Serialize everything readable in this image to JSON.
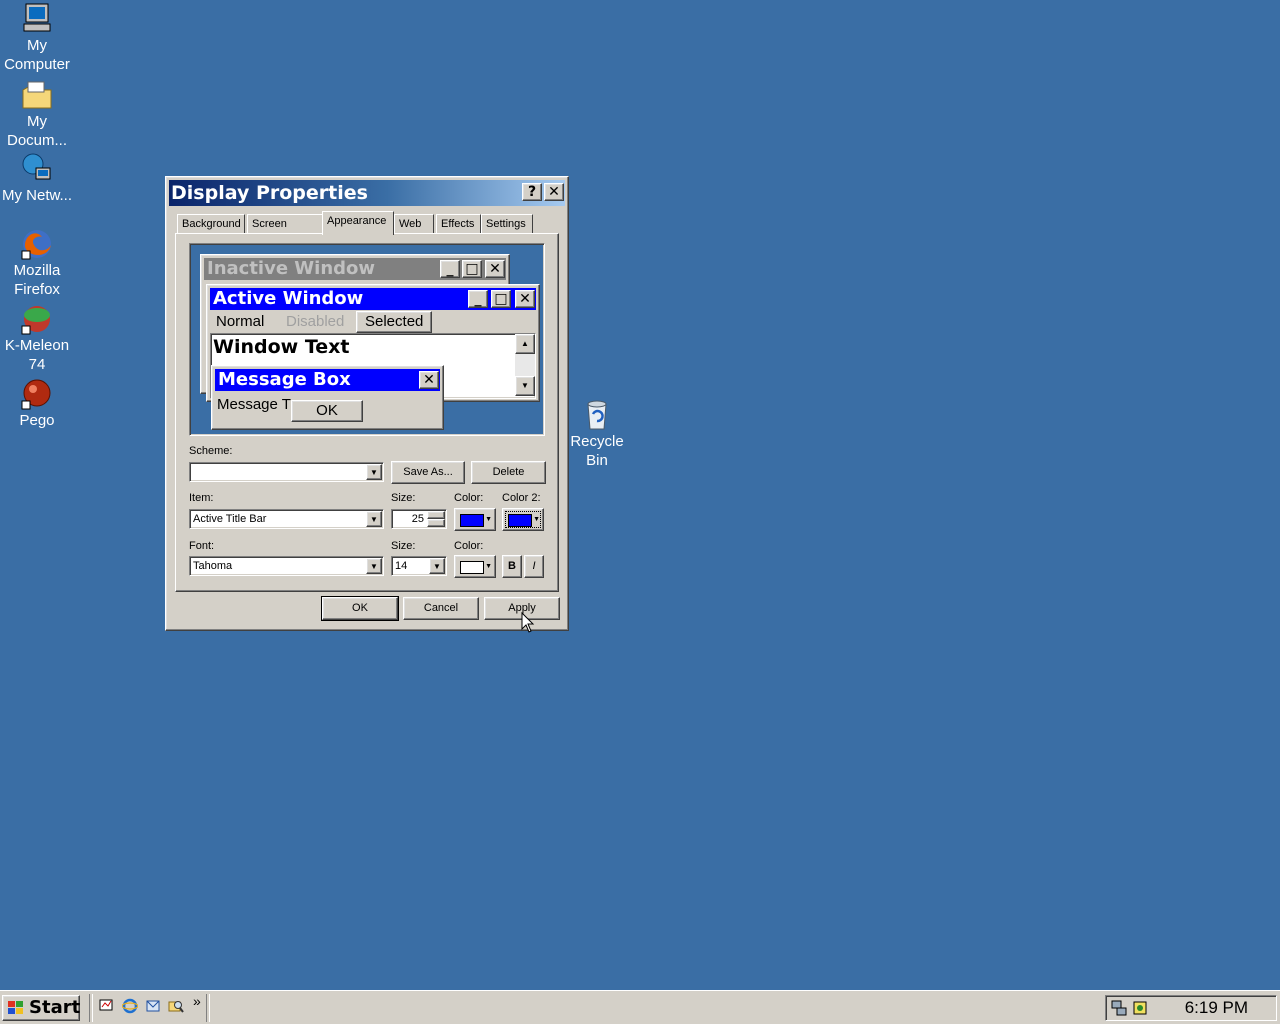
{
  "desktop": {
    "icons": [
      {
        "label": "My Computer",
        "icon": "my-computer-icon"
      },
      {
        "label": "My Docum...",
        "icon": "my-documents-icon"
      },
      {
        "label": "My Netw...",
        "icon": "network-icon"
      },
      {
        "label": "Mozilla Firefox",
        "icon": "firefox-icon"
      },
      {
        "label": "K-Meleon 74",
        "icon": "k-meleon-icon"
      },
      {
        "label": "Pego",
        "icon": "pego-icon"
      },
      {
        "label": "Recycle Bin",
        "icon": "recycle-bin-icon"
      }
    ],
    "background_color": "#3a6ea5"
  },
  "dialog": {
    "title": "Display Properties",
    "help_btn": "?",
    "close_btn": "✕",
    "tabs": [
      "Background",
      "Screen Saver",
      "Appearance",
      "Web",
      "Effects",
      "Settings"
    ],
    "active_tab": "Appearance",
    "preview": {
      "inactive_title": "Inactive Window",
      "active_title": "Active Window",
      "menu": [
        "Normal",
        "Disabled",
        "Selected"
      ],
      "window_text": "Window Text",
      "message_box_title": "Message Box",
      "message_text": "Message T",
      "ok_label": "OK",
      "active_color": "#0000ff",
      "inactive_color": "#808080"
    },
    "scheme": {
      "label": "Scheme:",
      "value": "",
      "save_as": "Save As...",
      "delete": "Delete"
    },
    "item": {
      "label": "Item:",
      "value": "Active Title Bar",
      "size_label": "Size:",
      "size_value": "25",
      "color_label": "Color:",
      "color2_label": "Color 2:",
      "color": "#0000ff",
      "color2": "#0000ff"
    },
    "font": {
      "label": "Font:",
      "value": "Tahoma",
      "size_label": "Size:",
      "size_value": "14",
      "color_label": "Color:",
      "color": "#ffffff",
      "bold": "B",
      "italic": "I"
    },
    "buttons": {
      "ok": "OK",
      "cancel": "Cancel",
      "apply": "Apply"
    }
  },
  "taskbar": {
    "start": "Start",
    "quicklaunch": [
      "show-desktop-icon",
      "ie-icon",
      "outlook-icon",
      "explore-icon"
    ],
    "more": "»",
    "clock": "6:19 PM"
  }
}
